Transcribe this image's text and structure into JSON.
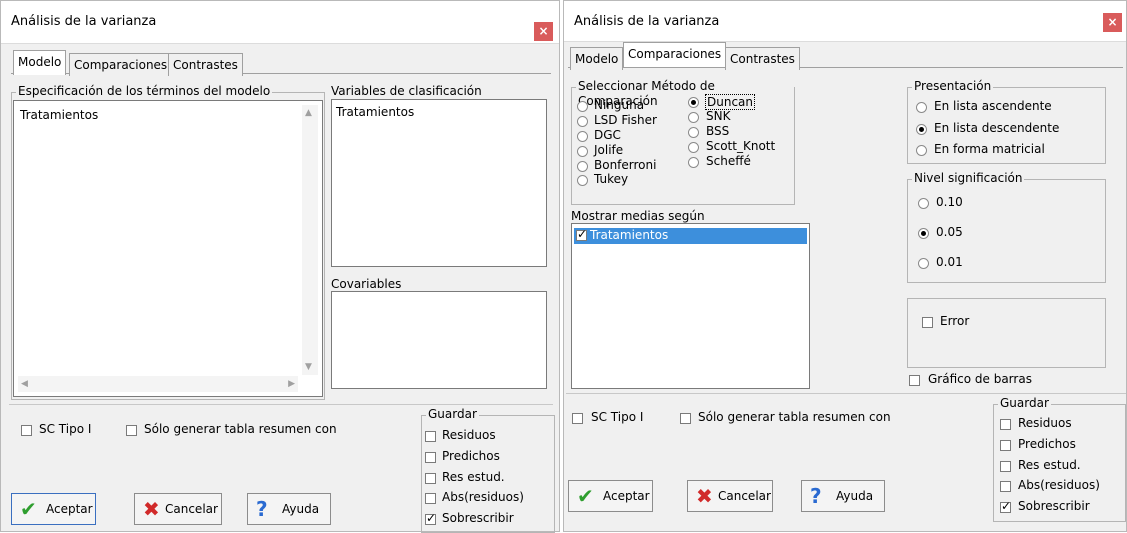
{
  "left": {
    "title": "Análisis de la varianza",
    "close": "×",
    "tabs": [
      "Modelo",
      "Comparaciones",
      "Contrastes"
    ],
    "model_group_label": "Especificación de los términos del modelo",
    "model_items": [
      "Tratamientos"
    ],
    "class_vars_label": "Variables de clasificación",
    "class_vars_items": [
      "Tratamientos"
    ],
    "covariables_label": "Covariables",
    "sc_tipo_label": "SC Tipo I",
    "solo_label": "Sólo generar tabla resumen con",
    "guardar_label": "Guardar",
    "guardar": [
      {
        "label": "Residuos",
        "checked": false
      },
      {
        "label": "Predichos",
        "checked": false
      },
      {
        "label": "Res estud.",
        "checked": false
      },
      {
        "label": "Abs(residuos)",
        "checked": false
      },
      {
        "label": "Sobrescribir",
        "checked": true
      }
    ],
    "buttons": {
      "accept": "Aceptar",
      "cancel": "Cancelar",
      "help": "Ayuda"
    }
  },
  "right": {
    "title": "Análisis de la varianza",
    "close": "×",
    "tabs": [
      "Modelo",
      "Comparaciones",
      "Contrastes"
    ],
    "method_group_label": "Seleccionar Método de Comparación",
    "methods_col1": [
      "Ninguna",
      "LSD Fisher",
      "DGC",
      "Jolife",
      "Bonferroni",
      "Tukey"
    ],
    "methods_col2": [
      "Duncan",
      "SNK",
      "BSS",
      "Scott_Knott",
      "Scheffé"
    ],
    "selected_method": "Duncan",
    "presentacion_label": "Presentación",
    "presentacion": [
      "En lista ascendente",
      "En lista descendente",
      "En forma matricial"
    ],
    "selected_presentacion": "En lista descendente",
    "nivel_label": "Nivel significación",
    "niveles": [
      "0.10",
      "0.05",
      "0.01"
    ],
    "selected_nivel": "0.05",
    "mostrar_label": "Mostrar medias según",
    "mostrar_items": [
      {
        "label": "Tratamientos",
        "checked": true
      }
    ],
    "error_label": "Error",
    "grafico_label": "Gráfico de barras",
    "sc_tipo_label": "SC Tipo I",
    "solo_label": "Sólo generar tabla resumen con",
    "guardar_label": "Guardar",
    "guardar": [
      {
        "label": "Residuos",
        "checked": false
      },
      {
        "label": "Predichos",
        "checked": false
      },
      {
        "label": "Res estud.",
        "checked": false
      },
      {
        "label": "Abs(residuos)",
        "checked": false
      },
      {
        "label": "Sobrescribir",
        "checked": true
      }
    ],
    "buttons": {
      "accept": "Aceptar",
      "cancel": "Cancelar",
      "help": "Ayuda"
    }
  }
}
